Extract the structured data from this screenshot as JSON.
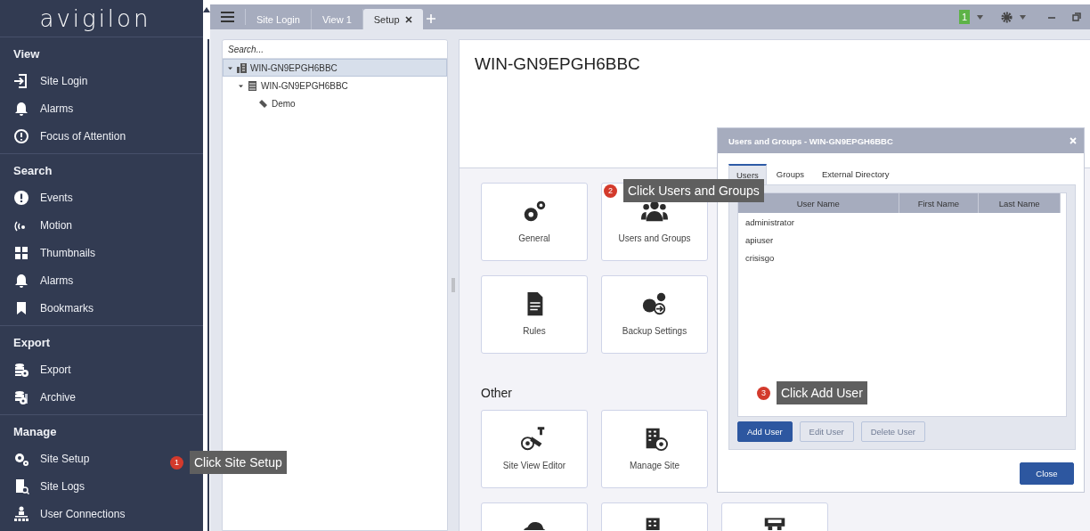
{
  "sidebar": {
    "logo": "avigilon",
    "sections": [
      {
        "title": "View",
        "items": [
          "Site Login",
          "Alarms",
          "Focus of Attention"
        ]
      },
      {
        "title": "Search",
        "items": [
          "Events",
          "Motion",
          "Thumbnails",
          "Alarms",
          "Bookmarks"
        ]
      },
      {
        "title": "Export",
        "items": [
          "Export",
          "Archive"
        ]
      },
      {
        "title": "Manage",
        "items": [
          "Site Setup",
          "Site Logs",
          "User Connections"
        ]
      }
    ]
  },
  "tabs": [
    {
      "label": "Site Login",
      "selected": false
    },
    {
      "label": "View 1",
      "selected": false
    },
    {
      "label": "Setup",
      "selected": true
    }
  ],
  "notification_count": "1",
  "tree": {
    "search_placeholder": "Search...",
    "nodes": [
      {
        "label": "WIN-GN9EPGH6BBC",
        "selected": true,
        "expanded": true,
        "children": [
          {
            "label": "WIN-GN9EPGH6BBC",
            "selected": false,
            "expanded": true,
            "children": [
              {
                "label": "Demo",
                "selected": false
              }
            ]
          }
        ]
      }
    ]
  },
  "setup": {
    "title": "WIN-GN9EPGH6BBC",
    "sections": [
      {
        "rows": [
          [
            {
              "kind": "full",
              "label": "General"
            },
            {
              "kind": "full",
              "label": "Users and Groups"
            }
          ],
          [
            {
              "kind": "full",
              "label": "Rules"
            },
            {
              "kind": "full",
              "label": "Backup Settings"
            }
          ]
        ]
      },
      {
        "heading": "Other",
        "rows": [
          [
            {
              "kind": "full",
              "label": "Site View Editor"
            },
            {
              "kind": "full",
              "label": "Manage Site"
            }
          ],
          [
            {
              "kind": "cut"
            },
            {
              "kind": "cut"
            },
            {
              "kind": "cut"
            }
          ]
        ]
      }
    ]
  },
  "dialog": {
    "title": "Users and Groups - WIN-GN9EPGH6BBC",
    "tabs": [
      {
        "label": "Users",
        "selected": true
      },
      {
        "label": "Groups",
        "selected": false
      },
      {
        "label": "External Directory",
        "selected": false
      }
    ],
    "columns": [
      "User Name",
      "First Name",
      "Last Name"
    ],
    "users": [
      "administrator",
      "apiuser",
      "crisisgo"
    ],
    "buttons": [
      {
        "label": "Add User",
        "disabled": false
      },
      {
        "label": "Edit User",
        "disabled": true
      },
      {
        "label": "Delete User",
        "disabled": true
      }
    ],
    "close_button": "Close"
  },
  "callouts": [
    {
      "number": "1",
      "text": "Click Site Setup"
    },
    {
      "number": "2",
      "text": "Click Users and Groups"
    },
    {
      "number": "3",
      "text": "Click Add User"
    }
  ]
}
